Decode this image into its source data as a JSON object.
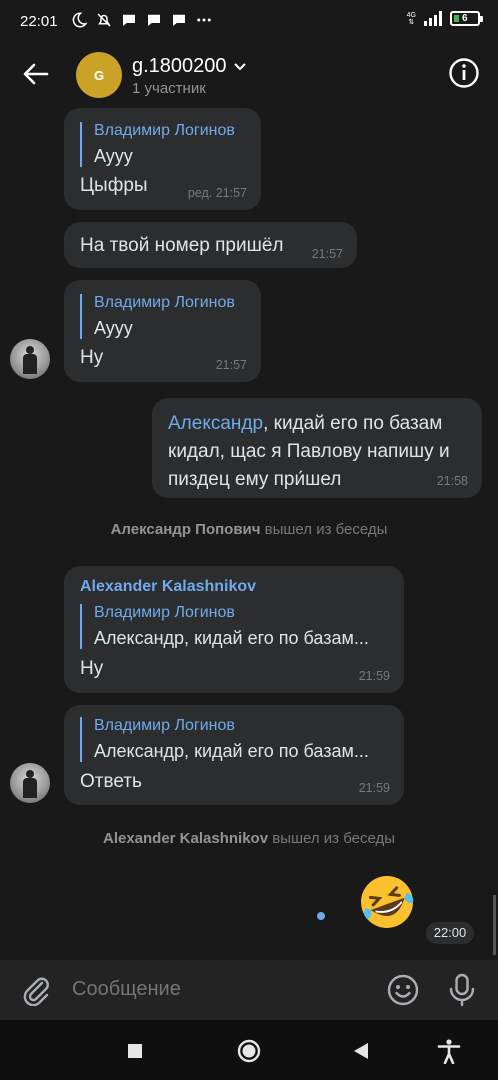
{
  "status_bar": {
    "time": "22:01",
    "network": "4G",
    "battery": "6",
    "icons": [
      "moon-icon",
      "muted-notifications-icon",
      "chat-bubble-icon",
      "chat-bubble-icon",
      "chat-bubble-icon",
      "more-dots-icon"
    ]
  },
  "header": {
    "avatar_letter": "G",
    "title": "g.1800200",
    "subtitle": "1 участник"
  },
  "messages": [
    {
      "quote_name": "Владимир Логинов",
      "quote_text": "Аууу",
      "text": "Цыфры",
      "time": "ред. 21:57"
    },
    {
      "text": "На твой номер пришёл",
      "time": "21:57"
    },
    {
      "quote_name": "Владимир Логинов",
      "quote_text": "Аууу",
      "text": "Ну",
      "time": "21:57"
    },
    {
      "mention": "Александр",
      "text_line1": ", кидай его по базам",
      "text_line2": "кидал, щас я Павлову напишу и",
      "text_line3": "пиздец ему при́шел",
      "time": "21:58"
    },
    {
      "name": "Александр Попович",
      "action": " вышел из беседы"
    },
    {
      "sender": "Alexander Kalashnikov",
      "quote_name": "Владимир Логинов",
      "quote_text": "Александр, кидай его по базам...",
      "text": "Ну",
      "time": "21:59"
    },
    {
      "quote_name": "Владимир Логинов",
      "quote_text": "Александр, кидай его по базам...",
      "text": "Ответь",
      "time": "21:59"
    },
    {
      "name": "Alexander Kalashnikov",
      "action": " вышел из беседы"
    },
    {
      "emoji": "🤣",
      "time": "22:00"
    }
  ],
  "composer": {
    "placeholder": "Сообщение"
  },
  "colors": {
    "background": "#19191a",
    "bubble": "#2c2d2e",
    "accent": "#71aaeb",
    "avatar_gold": "#c9a227"
  }
}
